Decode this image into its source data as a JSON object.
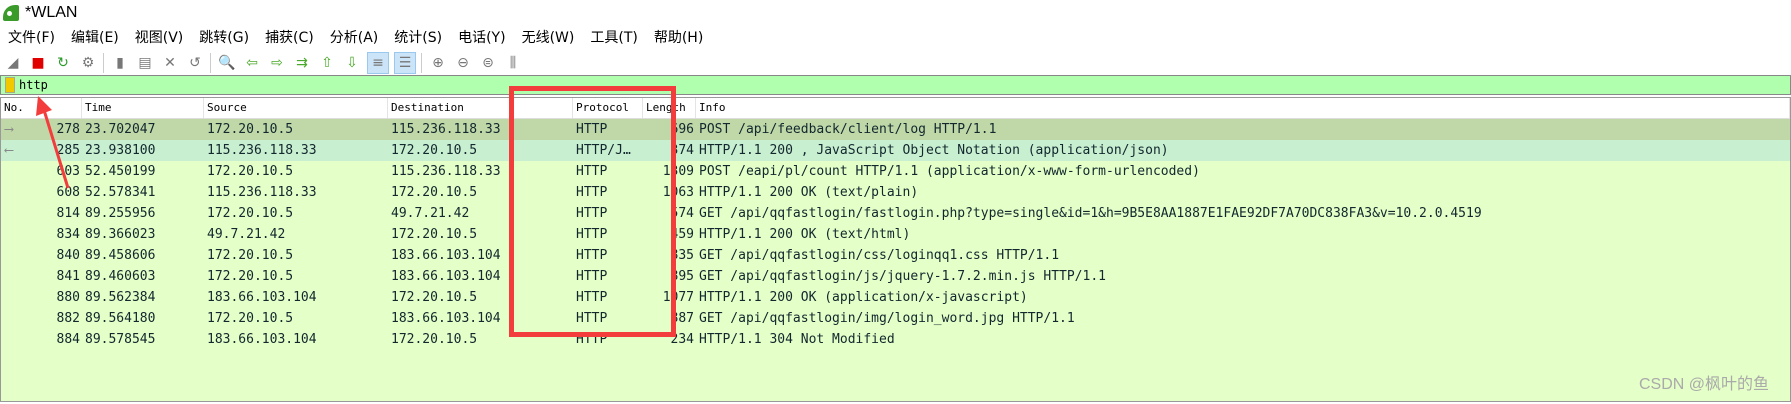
{
  "title": "*WLAN",
  "menu": [
    "文件(F)",
    "编辑(E)",
    "视图(V)",
    "跳转(G)",
    "捕获(C)",
    "分析(A)",
    "统计(S)",
    "电话(Y)",
    "无线(W)",
    "工具(T)",
    "帮助(H)"
  ],
  "toolbar": [
    {
      "icon": "shark-fin-start-icon",
      "glyph": "◢"
    },
    {
      "icon": "stop-capture-icon",
      "glyph": "■"
    },
    {
      "icon": "restart-capture-icon",
      "glyph": "↻"
    },
    {
      "icon": "capture-options-icon",
      "glyph": "⚙"
    },
    {
      "icon": "open-file-icon",
      "glyph": "▮"
    },
    {
      "icon": "save-file-icon",
      "glyph": "▤"
    },
    {
      "icon": "close-file-icon",
      "glyph": "✕"
    },
    {
      "icon": "reload-file-icon",
      "glyph": "↺"
    },
    {
      "icon": "find-packet-icon",
      "glyph": "🔍"
    },
    {
      "icon": "go-back-icon",
      "glyph": "⇦"
    },
    {
      "icon": "go-forward-icon",
      "glyph": "⇨"
    },
    {
      "icon": "go-to-packet-icon",
      "glyph": "⇉"
    },
    {
      "icon": "first-packet-icon",
      "glyph": "⇧"
    },
    {
      "icon": "last-packet-icon",
      "glyph": "⇩"
    },
    {
      "icon": "auto-scroll-icon",
      "glyph": "≡"
    },
    {
      "icon": "colorize-icon",
      "glyph": "☰"
    },
    {
      "icon": "zoom-in-icon",
      "glyph": "⊕"
    },
    {
      "icon": "zoom-out-icon",
      "glyph": "⊖"
    },
    {
      "icon": "normal-size-icon",
      "glyph": "⊜"
    },
    {
      "icon": "resize-columns-icon",
      "glyph": "⫼"
    }
  ],
  "filter": {
    "value": "http"
  },
  "columns": [
    "No.",
    "Time",
    "Source",
    "Destination",
    "Protocol",
    "Length",
    "Info"
  ],
  "rows": [
    [
      "278",
      "23.702047",
      "172.20.10.5",
      "115.236.118.33",
      "HTTP",
      "696",
      "POST /api/feedback/client/log HTTP/1.1"
    ],
    [
      "285",
      "23.938100",
      "115.236.118.33",
      "172.20.10.5",
      "HTTP/J…",
      "374",
      "HTTP/1.1 200  , JavaScript Object Notation (application/json)"
    ],
    [
      "603",
      "52.450199",
      "172.20.10.5",
      "115.236.118.33",
      "HTTP",
      "1309",
      "POST /eapi/pl/count HTTP/1.1  (application/x-www-form-urlencoded)"
    ],
    [
      "608",
      "52.578341",
      "115.236.118.33",
      "172.20.10.5",
      "HTTP",
      "1063",
      "HTTP/1.1 200 OK  (text/plain)"
    ],
    [
      "814",
      "89.255956",
      "172.20.10.5",
      "49.7.21.42",
      "HTTP",
      "574",
      "GET /api/qqfastlogin/fastlogin.php?type=single&id=1&h=9B5E8AA1887E1FAE92DF7A70DC838FA3&v=10.2.0.4519"
    ],
    [
      "834",
      "89.366023",
      "49.7.21.42",
      "172.20.10.5",
      "HTTP",
      "459",
      "HTTP/1.1 200 OK  (text/html)"
    ],
    [
      "840",
      "89.458606",
      "172.20.10.5",
      "183.66.103.104",
      "HTTP",
      "835",
      "GET /api/qqfastlogin/css/loginqq1.css HTTP/1.1"
    ],
    [
      "841",
      "89.460603",
      "172.20.10.5",
      "183.66.103.104",
      "HTTP",
      "895",
      "GET /api/qqfastlogin/js/jquery-1.7.2.min.js HTTP/1.1"
    ],
    [
      "880",
      "89.562384",
      "183.66.103.104",
      "172.20.10.5",
      "HTTP",
      "1077",
      "HTTP/1.1 200 OK  (application/x-javascript)"
    ],
    [
      "882",
      "89.564180",
      "172.20.10.5",
      "183.66.103.104",
      "HTTP",
      "887",
      "GET /api/qqfastlogin/img/login_word.jpg HTTP/1.1"
    ],
    [
      "884",
      "89.578545",
      "183.66.103.104",
      "172.20.10.5",
      "HTTP",
      "234",
      "HTTP/1.1 304 Not Modified"
    ]
  ],
  "watermark": "CSDN @枫叶的鱼",
  "colors": {
    "filter_ok": "#afffaf",
    "row": "#e4ffc7",
    "selected": "#c0d8a8",
    "annotation": "#f33c3c"
  }
}
